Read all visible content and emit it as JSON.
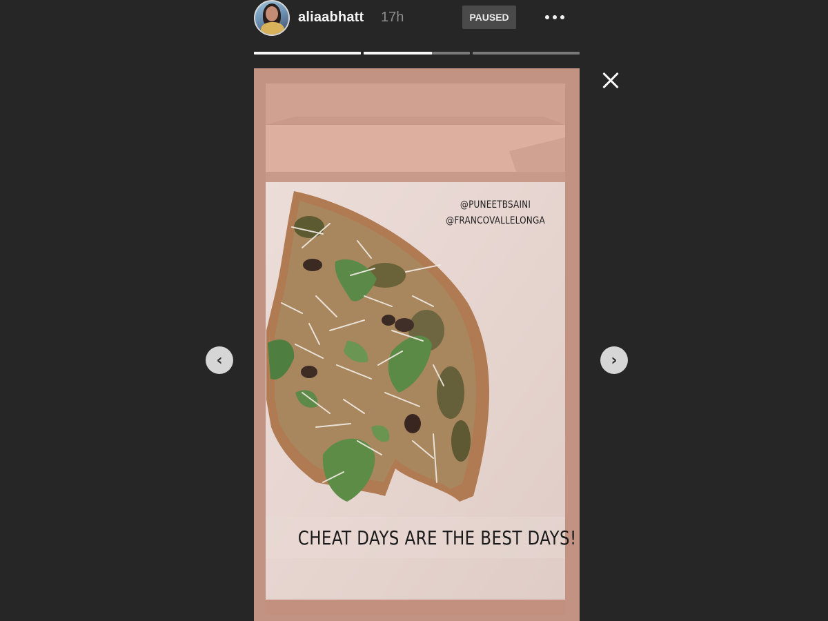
{
  "header": {
    "username": "aliaabhatt",
    "timestamp": "17h",
    "status_badge": "PAUSED",
    "more_icon": "more-horizontal-icon"
  },
  "progress": [
    {
      "state": "complete",
      "fill": 1.0
    },
    {
      "state": "current",
      "fill": 0.64
    },
    {
      "state": "upcoming",
      "fill": 0.0
    }
  ],
  "close_icon": "close-icon",
  "nav": {
    "prev_glyph": "‹",
    "next_glyph": "›"
  },
  "story": {
    "mentions": [
      "@PUNEETBSAINI",
      "@FRANCOVALLELONGA"
    ],
    "caption": "CHEAT DAYS ARE THE BEST DAYS!"
  },
  "colors": {
    "background": "#262626",
    "badge": "#4a4a4a",
    "progress_active": "#f7f7f7",
    "progress_inactive": "#7a7a7a"
  }
}
